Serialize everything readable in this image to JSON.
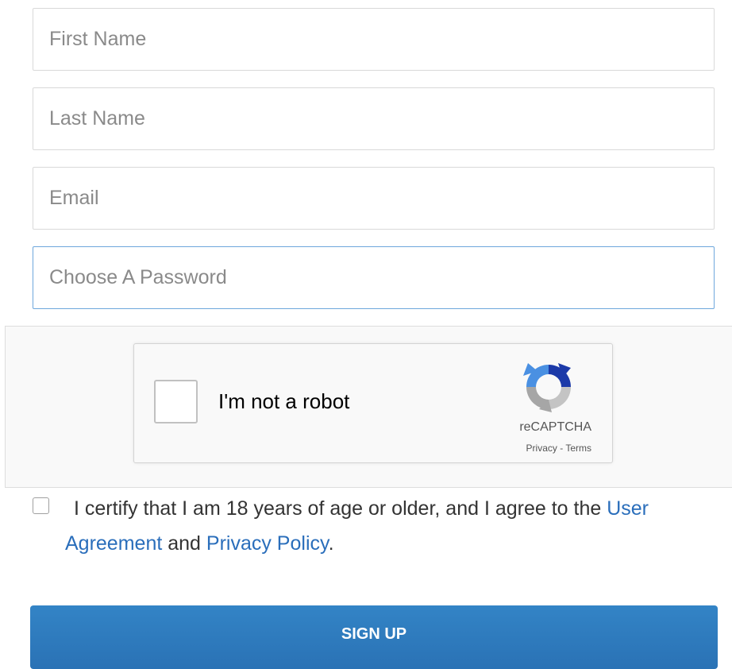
{
  "form": {
    "fields": [
      {
        "name": "first_name",
        "placeholder": "First Name",
        "value": ""
      },
      {
        "name": "last_name",
        "placeholder": "Last Name",
        "value": ""
      },
      {
        "name": "email",
        "placeholder": "Email",
        "value": ""
      },
      {
        "name": "password",
        "placeholder": "Choose A Password",
        "value": "",
        "focused": true
      }
    ]
  },
  "captcha": {
    "label": "I'm not a robot",
    "brand": "reCAPTCHA",
    "privacy_link": "Privacy",
    "separator": " - ",
    "terms_link": "Terms",
    "logo_icon": "recaptcha-logo-icon",
    "checked": false
  },
  "agreement": {
    "checked": false,
    "text_before": "I certify that I am 18 years of age or older, and I agree to the ",
    "user_agreement_part1": "User",
    "user_agreement_part2": "Agreement",
    "text_middle": " and ",
    "privacy_policy": "Privacy Policy",
    "text_end": "."
  },
  "signup": {
    "label": "SIGN UP"
  },
  "colors": {
    "link": "#2a6ebb",
    "button": "#2f7bbf",
    "focus_border": "#6ea7dc"
  }
}
